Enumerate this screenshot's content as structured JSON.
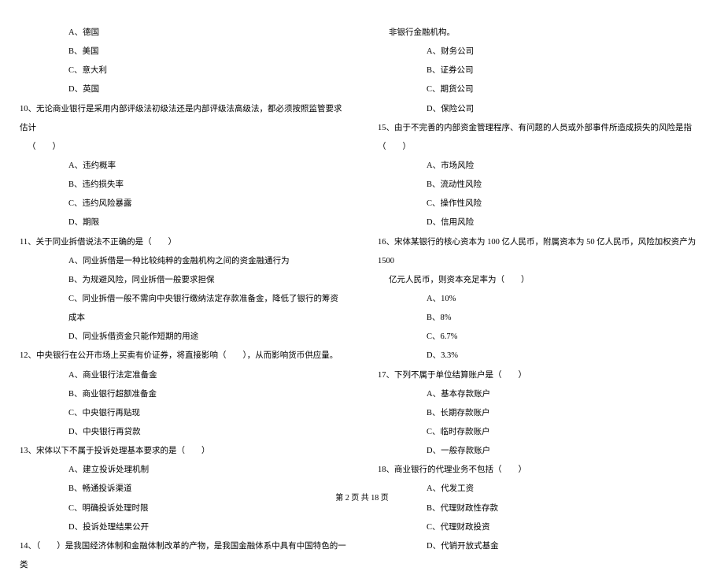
{
  "left": {
    "q9_options": {
      "a": "A、德国",
      "b": "B、美国",
      "c": "C、意大利",
      "d": "D、英国"
    },
    "q10": {
      "stem": "10、无论商业银行是采用内部评级法初级法还是内部评级法高级法，都必须按照监管要求估计",
      "stem2": "（　　）",
      "a": "A、违约概率",
      "b": "B、违约损失率",
      "c": "C、违约风险暴露",
      "d": "D、期限"
    },
    "q11": {
      "stem": "11、关于同业拆借说法不正确的是（　　）",
      "a": "A、同业拆借是一种比较纯粹的金融机构之间的资金融通行为",
      "b": "B、为规避风险，同业拆借一般要求担保",
      "c": "C、同业拆借一般不需向中央银行缴纳法定存款准备金，降低了银行的筹资成本",
      "d": "D、同业拆借资金只能作短期的用途"
    },
    "q12": {
      "stem": "12、中央银行在公开市场上买卖有价证券，将直接影响（　　），从而影响货币供应量。",
      "a": "A、商业银行法定准备金",
      "b": "B、商业银行超额准备金",
      "c": "C、中央银行再贴现",
      "d": "D、中央银行再贷款"
    },
    "q13": {
      "stem": "13、宋体以下不属于投诉处理基本要求的是（　　）",
      "a": "A、建立投诉处理机制",
      "b": "B、畅通投诉渠道",
      "c": "C、明确投诉处理时限",
      "d": "D、投诉处理结果公开"
    },
    "q14": {
      "stem": "14、（　　）是我国经济体制和金融体制改革的产物，是我国金融体系中具有中国特色的一类"
    }
  },
  "right": {
    "q14_cont": {
      "cont": "非银行金融机构。",
      "a": "A、财务公司",
      "b": "B、证券公司",
      "c": "C、期货公司",
      "d": "D、保险公司"
    },
    "q15": {
      "stem": "15、由于不完善的内部资金管理程序、有问题的人员或外部事件所造成损失的风险是指（　　）",
      "a": "A、市场风险",
      "b": "B、流动性风险",
      "c": "C、操作性风险",
      "d": "D、信用风险"
    },
    "q16": {
      "stem": "16、宋体某银行的核心资本为 100 亿人民币，附属资本为 50 亿人民币，风险加权资产为 1500",
      "stem2": "亿元人民币，则资本充足率为（　　）",
      "a": "A、10%",
      "b": "B、8%",
      "c": "C、6.7%",
      "d": "D、3.3%"
    },
    "q17": {
      "stem": "17、下列不属于单位结算账户是（　　）",
      "a": "A、基本存款账户",
      "b": "B、长期存款账户",
      "c": "C、临时存款账户",
      "d": "D、一般存款账户"
    },
    "q18": {
      "stem": "18、商业银行的代理业务不包括（　　）",
      "a": "A、代发工资",
      "b": "B、代理财政性存款",
      "c": "C、代理财政投资",
      "d": "D、代销开放式基金"
    }
  },
  "footer": "第 2 页 共 18 页"
}
